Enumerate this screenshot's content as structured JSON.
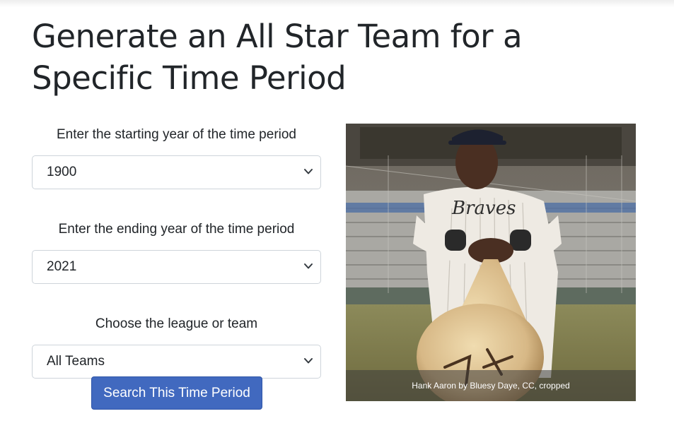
{
  "page": {
    "title": "Generate an All Star Team for a Specific Time Period"
  },
  "form": {
    "start_label": "Enter the starting year of the time period",
    "start_value": "1900",
    "end_label": "Enter the ending year of the time period",
    "end_value": "2021",
    "team_label": "Choose the league or team",
    "team_value": "All Teams",
    "submit_label": "Search This Time Period"
  },
  "photo": {
    "caption": "Hank Aaron by Bluesy Daye, CC, cropped",
    "alt": "Hank Aaron holding a baseball bat"
  },
  "icons": {
    "select_chevron": "chevron-down-icon"
  },
  "colors": {
    "button_bg": "#4169bf",
    "text": "#212529"
  }
}
